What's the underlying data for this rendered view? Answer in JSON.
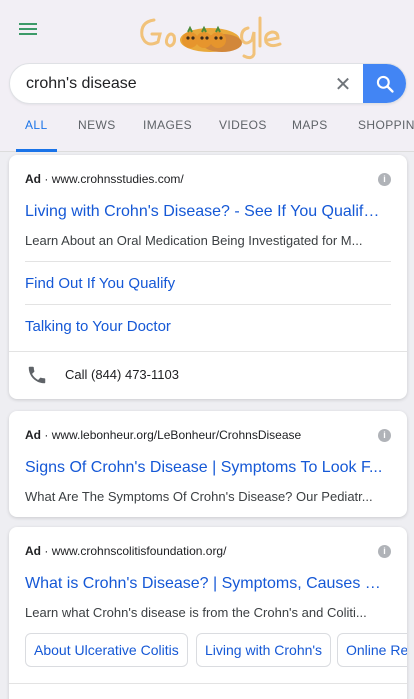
{
  "header": {
    "doodle_alt": "Google",
    "search": {
      "value": "crohn's disease",
      "placeholder": ""
    },
    "tabs": [
      "ALL",
      "NEWS",
      "IMAGES",
      "VIDEOS",
      "MAPS",
      "SHOPPING"
    ],
    "active_tab": "ALL"
  },
  "colors": {
    "link": "#1558d6",
    "accent": "#1a73e8",
    "search_button": "#4285f4"
  },
  "ads": [
    {
      "badge": "Ad",
      "url": "www.crohnsstudies.com/",
      "title": "Living with Crohn's Disease? - See If You Qualify ...",
      "description": "Learn About an Oral Medication Being Investigated for M...",
      "sitelinks": [
        "Find Out If You Qualify",
        "Talking to Your Doctor"
      ],
      "call": "Call (844) 473-1103"
    },
    {
      "badge": "Ad",
      "url": "www.lebonheur.org/LeBonheur/CrohnsDisease",
      "title": "Signs Of Crohn's Disease | Symptoms To Look F...",
      "description": "What Are The Symptoms Of Crohn's Disease? Our Pediatr..."
    },
    {
      "badge": "Ad",
      "url": "www.crohnscolitisfoundation.org/",
      "title": "What is Crohn's Disease? | Symptoms, Causes & ...",
      "description": "Learn what Crohn's disease is from the Crohn's and Coliti...",
      "chips": [
        "About Ulcerative Colitis",
        "Living with Crohn's",
        "Online Res"
      ]
    }
  ]
}
